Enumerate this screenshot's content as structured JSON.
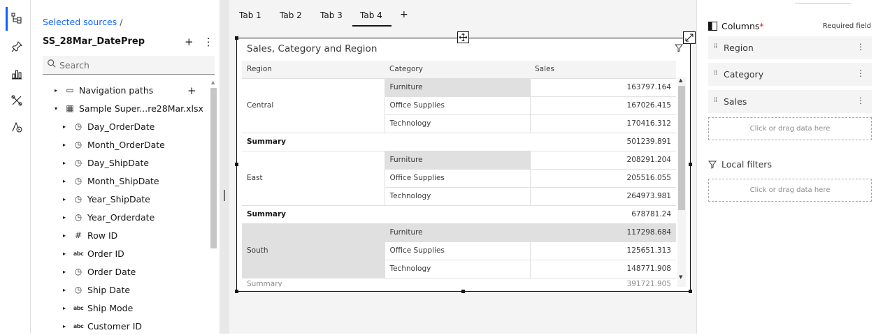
{
  "rail": {
    "items": [
      {
        "name": "selected-sources-icon",
        "glyph": "⊶"
      },
      {
        "name": "pin-icon",
        "glyph": "⚲"
      },
      {
        "name": "visualizations-icon",
        "glyph": "📊"
      },
      {
        "name": "custom-widgets-icon",
        "glyph": "✂"
      },
      {
        "name": "navigation-path-icon",
        "glyph": "⚇"
      }
    ]
  },
  "sources": {
    "breadcrumb": "Selected sources",
    "breadcrumb_sep": "/",
    "module_name": "SS_28Mar_DatePrep",
    "add_glyph": "+",
    "more_glyph": "⋮",
    "search_placeholder": "Search",
    "tree_add_glyph": "+",
    "tree": [
      {
        "label": "Navigation paths",
        "icon": "▭",
        "icon_name": "folder-icon",
        "level": 1,
        "caret": "▸"
      },
      {
        "label": "Sample Super...re28Mar.xlsx",
        "icon": "▦",
        "icon_name": "table-icon",
        "level": 1,
        "caret": "▾"
      },
      {
        "label": "Day_OrderDate",
        "icon": "◷",
        "icon_name": "clock-icon",
        "level": 2,
        "caret": "▸"
      },
      {
        "label": "Month_OrderDate",
        "icon": "◷",
        "icon_name": "clock-icon",
        "level": 2,
        "caret": "▸"
      },
      {
        "label": "Day_ShipDate",
        "icon": "◷",
        "icon_name": "clock-icon",
        "level": 2,
        "caret": "▸"
      },
      {
        "label": "Month_ShipDate",
        "icon": "◷",
        "icon_name": "clock-icon",
        "level": 2,
        "caret": "▸"
      },
      {
        "label": "Year_ShipDate",
        "icon": "◷",
        "icon_name": "clock-icon",
        "level": 2,
        "caret": "▸"
      },
      {
        "label": "Year_Orderdate",
        "icon": "◷",
        "icon_name": "clock-icon",
        "level": 2,
        "caret": "▸"
      },
      {
        "label": "Row ID",
        "icon": "#",
        "icon_name": "number-icon",
        "level": 2,
        "caret": "▸"
      },
      {
        "label": "Order ID",
        "icon": "abc",
        "icon_name": "text-icon",
        "level": 2,
        "caret": "▸"
      },
      {
        "label": "Order Date",
        "icon": "◷",
        "icon_name": "clock-icon",
        "level": 2,
        "caret": "▸"
      },
      {
        "label": "Ship Date",
        "icon": "◷",
        "icon_name": "clock-icon",
        "level": 2,
        "caret": "▸"
      },
      {
        "label": "Ship Mode",
        "icon": "abc",
        "icon_name": "text-icon",
        "level": 2,
        "caret": "▸"
      },
      {
        "label": "Customer ID",
        "icon": "abc",
        "icon_name": "text-icon",
        "level": 2,
        "caret": "▸"
      }
    ]
  },
  "canvas": {
    "tabs": [
      "Tab 1",
      "Tab 2",
      "Tab 3",
      "Tab 4"
    ],
    "active_tab": "Tab 4",
    "add_tab": "+",
    "widget": {
      "title": "Sales, Category and Region",
      "headers": [
        "Region",
        "Category",
        "Sales"
      ],
      "groups": [
        {
          "region": "Central",
          "rows": [
            [
              "Furniture",
              "163797.164"
            ],
            [
              "Office Supplies",
              "167026.415"
            ],
            [
              "Technology",
              "170416.312"
            ]
          ],
          "summary_label": "Summary",
          "summary_value": "501239.891"
        },
        {
          "region": "East",
          "rows": [
            [
              "Furniture",
              "208291.204"
            ],
            [
              "Office Supplies",
              "205516.055"
            ],
            [
              "Technology",
              "264973.981"
            ]
          ],
          "summary_label": "Summary",
          "summary_value": "678781.24"
        },
        {
          "region": "South",
          "rows": [
            [
              "Furniture",
              "117298.684"
            ],
            [
              "Office Supplies",
              "125651.313"
            ],
            [
              "Technology",
              "148771.908"
            ]
          ]
        }
      ],
      "cut_row": {
        "label": "Summary",
        "value": "391721.905"
      }
    }
  },
  "props": {
    "columns_label": "Columns",
    "required_star": "*",
    "required_field": "Required field",
    "slots": [
      "Region",
      "Category",
      "Sales"
    ],
    "dropzone_text": "Click or drag data here",
    "local_filters_label": "Local filters",
    "filters_dropzone_text": "Click or drag data here"
  },
  "colors": {
    "accent": "#0f62fe",
    "required": "#da1e28",
    "highlight": "#e0e0e0"
  }
}
